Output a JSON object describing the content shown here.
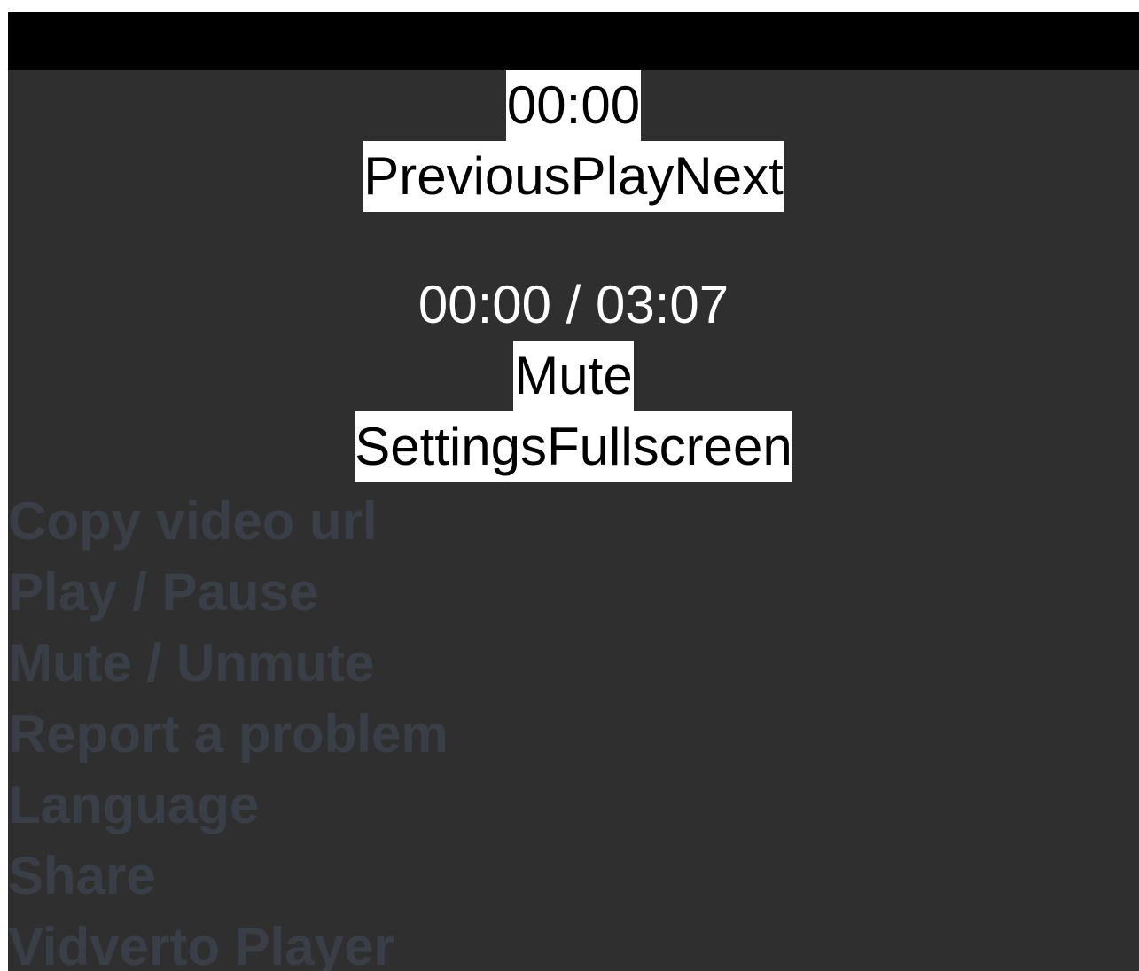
{
  "player": {
    "current_time": "00:00",
    "controls": {
      "previous_label": "Previous",
      "play_label": "Play",
      "next_label": "Next",
      "time_display": "00:00 / 03:07",
      "mute_label": "Mute",
      "settings_label": "Settings",
      "fullscreen_label": "Fullscreen"
    },
    "context_menu": {
      "items": [
        {
          "label": "Copy video url"
        },
        {
          "label": "Play / Pause"
        },
        {
          "label": "Mute / Unmute"
        },
        {
          "label": "Report a problem"
        },
        {
          "label": "Language"
        },
        {
          "label": "Share"
        },
        {
          "label": "Vidverto Player"
        }
      ]
    }
  },
  "colors": {
    "player_background": "#2f2f2f",
    "video_area": "#000000",
    "button_background": "#ffffff",
    "menu_text": "#3a3f47"
  }
}
